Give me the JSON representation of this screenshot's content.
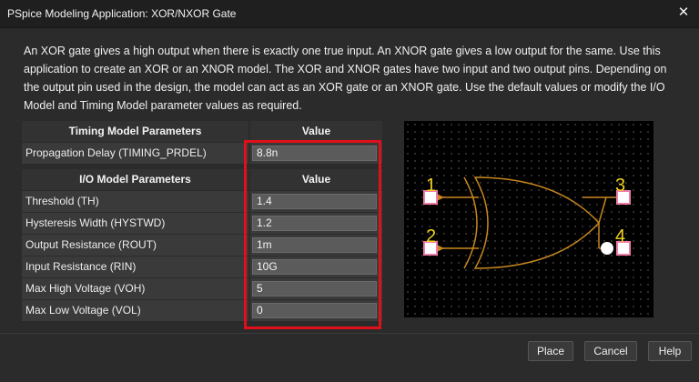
{
  "window": {
    "title": "PSpice Modeling Application: XOR/NXOR Gate",
    "close_glyph": "✕"
  },
  "description": "An XOR gate gives a high output when there is exactly one true input. An XNOR gate gives a low output for the same. Use this application to create an XOR or an XNOR model. The XOR and XNOR gates have two input and two output pins. Depending on the output pin used in the design, the model can act as an XOR gate or an XNOR gate. Use the default values or modify the I/O Model and Timing Model parameter values as required.",
  "timing_table": {
    "header_param": "Timing Model Parameters",
    "header_value": "Value",
    "rows": [
      {
        "label": "Propagation Delay (TIMING_PRDEL)",
        "value": "8.8n"
      }
    ]
  },
  "io_table": {
    "header_param": "I/O Model Parameters",
    "header_value": "Value",
    "rows": [
      {
        "label": "Threshold (TH)",
        "value": "1.4"
      },
      {
        "label": "Hysteresis Width (HYSTWD)",
        "value": "1.2"
      },
      {
        "label": "Output Resistance (ROUT)",
        "value": "1m"
      },
      {
        "label": "Input Resistance (RIN)",
        "value": "10G"
      },
      {
        "label": "Max High Voltage (VOH)",
        "value": "5"
      },
      {
        "label": "Max Low Voltage (VOL)",
        "value": "0"
      }
    ]
  },
  "schematic": {
    "pins": [
      "1",
      "2",
      "3",
      "4"
    ],
    "colors": {
      "gate": "#c8871e",
      "pin_box": "#f07aa8",
      "pin_label": "#f2d21a",
      "output_bubble": "#ffffff",
      "background": "#000000"
    }
  },
  "buttons": {
    "place": "Place",
    "cancel": "Cancel",
    "help": "Help"
  }
}
